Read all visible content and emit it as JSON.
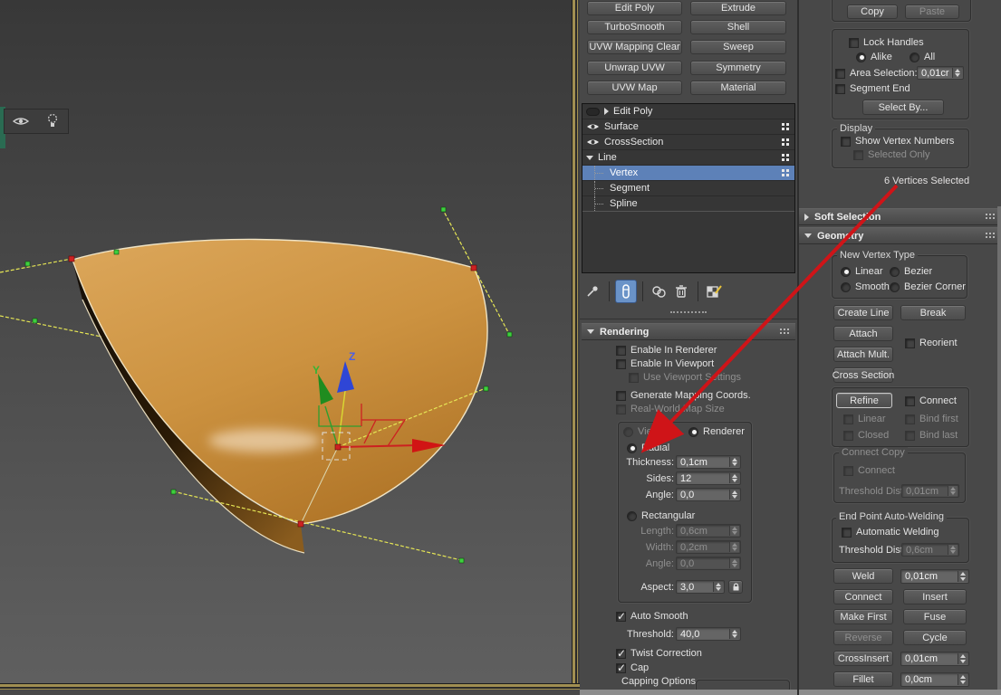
{
  "viewport": {
    "axis_z": "Z",
    "axis_y": "Y"
  },
  "mid": {
    "buttons": [
      [
        "Edit Poly",
        "Extrude"
      ],
      [
        "TurboSmooth",
        "Shell"
      ],
      [
        "UVW Mapping Clear",
        "Sweep"
      ],
      [
        "Unwrap UVW",
        "Symmetry"
      ],
      [
        "UVW Map",
        "Material"
      ]
    ],
    "stack": {
      "edit_poly": "Edit Poly",
      "surface": "Surface",
      "cross_section": "CrossSection",
      "line": "Line",
      "vertex": "Vertex",
      "segment": "Segment",
      "spline": "Spline"
    },
    "rendering": {
      "title": "Rendering",
      "enable_in_renderer": "Enable In Renderer",
      "enable_in_viewport": "Enable In Viewport",
      "use_viewport_settings": "Use Viewport Settings",
      "generate_mapping_coords": "Generate Mapping Coords.",
      "real_world_map_size": "Real-World Map Size",
      "viewport": "Viewport",
      "renderer": "Renderer",
      "radial": "Radial",
      "thickness_label": "Thickness:",
      "thickness": "0,1cm",
      "sides_label": "Sides:",
      "sides": "12",
      "angle_label": "Angle:",
      "angle": "0,0",
      "rectangular": "Rectangular",
      "length_label": "Length:",
      "length": "0,6cm",
      "width_label": "Width:",
      "width": "0,2cm",
      "angle2_label": "Angle:",
      "angle2": "0,0",
      "aspect_label": "Aspect:",
      "aspect": "3,0",
      "auto_smooth": "Auto Smooth",
      "threshold_label": "Threshold:",
      "threshold": "40,0",
      "twist_correction": "Twist Correction",
      "cap": "Cap",
      "capping_options": "Capping Options"
    }
  },
  "right": {
    "copy": "Copy",
    "paste": "Paste",
    "lock_handles": "Lock Handles",
    "alike": "Alike",
    "all": "All",
    "area_selection": "Area Selection:",
    "area_value": "0,01cr",
    "segment_end": "Segment End",
    "select_by": "Select By...",
    "display": "Display",
    "show_vertex_numbers": "Show Vertex Numbers",
    "selected_only": "Selected Only",
    "status": "6 Vertices Selected",
    "soft_selection": "Soft Selection",
    "geometry": "Geometry",
    "new_vertex_type": "New Vertex Type",
    "linear": "Linear",
    "bezier": "Bezier",
    "smooth": "Smooth",
    "bezier_corner": "Bezier Corner",
    "create_line": "Create Line",
    "break_btn": "Break",
    "attach": "Attach",
    "reorient": "Reorient",
    "attach_mult": "Attach Mult.",
    "cross_section": "Cross Section",
    "refine": "Refine",
    "connect_cb": "Connect",
    "linear_cb": "Linear",
    "bind_first": "Bind first",
    "closed": "Closed",
    "bind_last": "Bind last",
    "connect_copy": "Connect Copy",
    "cc_connect": "Connect",
    "threshold_dist": "Threshold Dist",
    "cc_value": "0,01cm",
    "end_point_auto_welding": "End Point Auto-Welding",
    "automatic_welding": "Automatic Welding",
    "weld_threshold": "0,6cm",
    "weld": "Weld",
    "weld_value": "0,01cm",
    "connect_btn": "Connect",
    "insert": "Insert",
    "make_first": "Make First",
    "fuse": "Fuse",
    "reverse": "Reverse",
    "cycle": "Cycle",
    "crossinsert": "CrossInsert",
    "crossinsert_value": "0,01cm",
    "fillet": "Fillet",
    "fillet_value": "0,0cm"
  },
  "colors": {
    "selection_blue": "#5d81b8",
    "annotation_red": "#cf1418",
    "shape_orange": "#cc9240",
    "handle_yellow": "#e6e655",
    "vertex_green": "#3ecf3e",
    "vertex_selected_red": "#cc2222",
    "viewport_border_tan": "#a18f52"
  }
}
